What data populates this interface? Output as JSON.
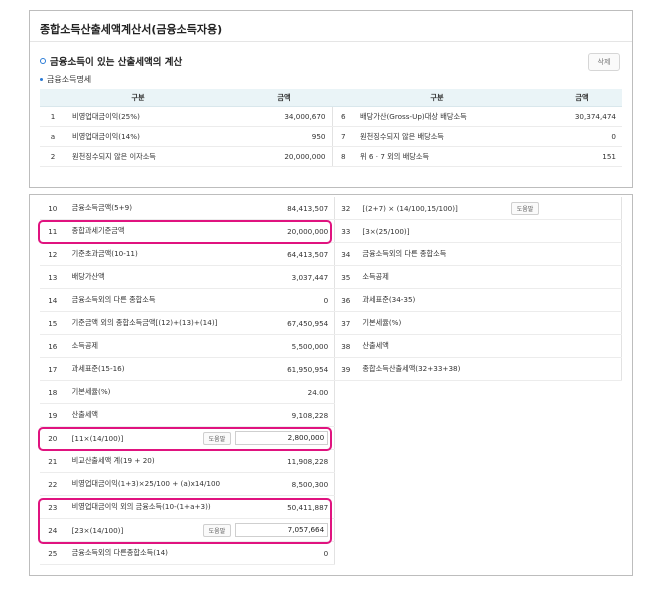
{
  "header": {
    "title": "종합소득산출세액계산서(금융소득자용)",
    "section_title": "금융소득이 있는 산출세액의 계산",
    "delete_label": "삭제",
    "subsection": "금융소득명세"
  },
  "top_table": {
    "col_gubun": "구분",
    "col_amount": "금액",
    "rows": [
      {
        "no": "1",
        "name": "비영업대금이익(25%)",
        "amount": "34,000,670",
        "no2": "6",
        "name2": "배당가산(Gross-Up)대상 배당소득",
        "amount2": "30,374,474"
      },
      {
        "no": "a",
        "name": "비영업대금이익(14%)",
        "amount": "950",
        "no2": "7",
        "name2": "원천징수되지 않은 배당소득",
        "amount2": "0"
      },
      {
        "no": "2",
        "name": "원천징수되지 않은 이자소득",
        "amount": "20,000,000",
        "no2": "8",
        "name2": "위 6 · 7 외의 배당소득",
        "amount2": "151"
      }
    ]
  },
  "bottom_table": {
    "help_label": "도움말",
    "rows": [
      {
        "no": "10",
        "name": "금융소득금액(5+9)",
        "amount": "84,413,507",
        "no2": "32",
        "name2": "[(2+7) × (14/100,15/100)]"
      },
      {
        "no": "11",
        "name": "종합과세기준금액",
        "amount": "20,000,000",
        "no2": "33",
        "name2": "[3×(25/100)]"
      },
      {
        "no": "12",
        "name": "기준초과금액(10-11)",
        "amount": "64,413,507",
        "no2": "34",
        "name2": "금융소득외의 다른 종합소득"
      },
      {
        "no": "13",
        "name": "배당가산액",
        "amount": "3,037,447",
        "no2": "35",
        "name2": "소득공제"
      },
      {
        "no": "14",
        "name": "금융소득외의 다른 종합소득",
        "amount": "0",
        "no2": "36",
        "name2": "과세표준(34-35)"
      },
      {
        "no": "15",
        "name": "기준금액 외의 종합소득금액[(12)+(13)+(14)]",
        "amount": "67,450,954",
        "no2": "37",
        "name2": "기본세율(%)"
      },
      {
        "no": "16",
        "name": "소득공제",
        "amount": "5,500,000",
        "no2": "38",
        "name2": "산출세액"
      },
      {
        "no": "17",
        "name": "과세표준(15-16)",
        "amount": "61,950,954",
        "no2": "39",
        "name2": "종합소득산출세액(32+33+38)"
      },
      {
        "no": "18",
        "name": "기본세율(%)",
        "amount": "24.00"
      },
      {
        "no": "19",
        "name": "산출세액",
        "amount": "9,108,228"
      },
      {
        "no": "20",
        "name": "[11×(14/100)]",
        "amount": "2,800,000"
      },
      {
        "no": "21",
        "name": "비교산출세액 계(19 + 20)",
        "amount": "11,908,228"
      },
      {
        "no": "22",
        "name": "비영업대금이익(1+3)×25/100 + (a)x14/100",
        "amount": "8,500,300"
      },
      {
        "no": "23",
        "name": "비영업대금이익 외의 금융소득(10-(1+a+3))",
        "amount": "50,411,887"
      },
      {
        "no": "24",
        "name": "[23×(14/100)]",
        "amount": "7,057,664"
      },
      {
        "no": "25",
        "name": "금융소득외의 다른종합소득(14)",
        "amount": "0"
      }
    ]
  },
  "colors": {
    "accent": "#2a7bd6",
    "highlight": "#e0137f",
    "header_bg": "#eaf4f7"
  }
}
